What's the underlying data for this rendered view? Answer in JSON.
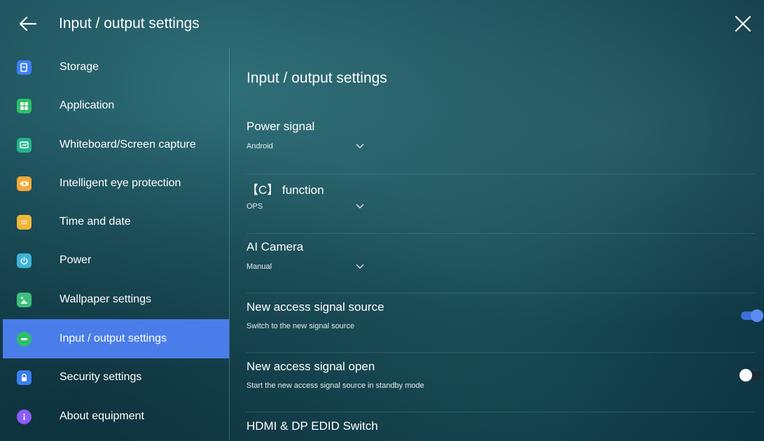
{
  "header": {
    "title": "Input / output settings"
  },
  "sidebar": {
    "items": [
      {
        "label": "Storage",
        "icon": "storage-icon",
        "color": "#3d7ef0"
      },
      {
        "label": "Application",
        "icon": "apps-icon",
        "color": "#2fbf6b"
      },
      {
        "label": "Whiteboard/Screen capture",
        "icon": "whiteboard-icon",
        "color": "#23b48d"
      },
      {
        "label": "Intelligent eye protection",
        "icon": "eye-icon",
        "color": "#f2a93b"
      },
      {
        "label": "Time and date",
        "icon": "calendar-icon",
        "color": "#f2b63b"
      },
      {
        "label": "Power",
        "icon": "power-icon",
        "color": "#3fb4d8"
      },
      {
        "label": "Wallpaper settings",
        "icon": "wallpaper-icon",
        "color": "#3cc07a"
      },
      {
        "label": "Input / output settings",
        "icon": "input-output-icon",
        "color": "#2fbf6b",
        "active": true
      },
      {
        "label": "Security settings",
        "icon": "lock-icon",
        "color": "#3d7ef0"
      },
      {
        "label": "About equipment",
        "icon": "info-icon",
        "color": "#8b5cf6"
      }
    ]
  },
  "main": {
    "title": "Input / output settings",
    "settings": [
      {
        "label": "Power signal",
        "value": "Android",
        "type": "dropdown"
      },
      {
        "label": "【C】 function",
        "value": "OPS",
        "type": "dropdown"
      },
      {
        "label": "AI Camera",
        "value": "Manual",
        "type": "dropdown"
      },
      {
        "label": "New access signal source",
        "description": "Switch to the new signal source",
        "type": "toggle",
        "enabled": true
      },
      {
        "label": "New access signal open",
        "description": "Start the new access signal source in standby mode",
        "type": "toggle",
        "enabled": false
      },
      {
        "label": "HDMI & DP EDID Switch",
        "type": "item"
      }
    ]
  },
  "colors": {
    "accent": "#4a7dea",
    "toggle_on_track": "#3f6fd6",
    "toggle_on_knob": "#5b8cf5",
    "toggle_off_track": "#1b2a30",
    "toggle_off_knob": "#ffffff"
  }
}
